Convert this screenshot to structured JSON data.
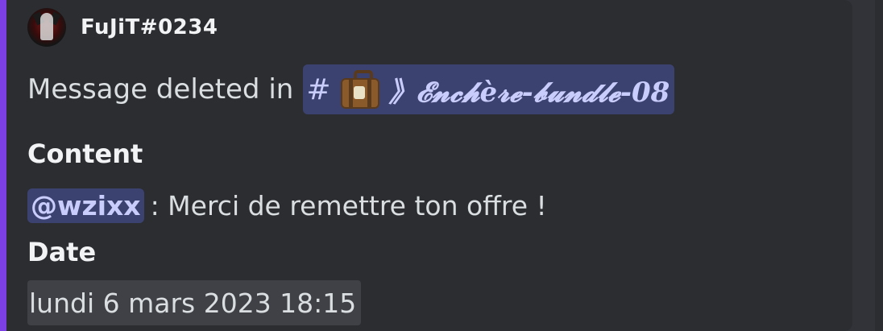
{
  "author": {
    "name": "FuJiT#0234"
  },
  "description": {
    "prefix": "Message deleted in",
    "channel_hash": "#",
    "channel_icon": "suitcase-icon",
    "channel_name": "》𝓔𝓷𝓬𝓱è𝓻𝓮-𝓫𝓾𝓷𝓭𝓵𝓮-08"
  },
  "fields": [
    {
      "name": "Content",
      "mention": "@wzixx",
      "text": " : Merci de remettre ton offre !"
    },
    {
      "name": "Date",
      "value": "lundi 6 mars 2023 18:15"
    }
  ],
  "colors": {
    "embed_accent": "#7b3fe4",
    "embed_background": "#2b2d31",
    "mention_background": "#3c4270",
    "mention_text": "#c9cdfb"
  }
}
